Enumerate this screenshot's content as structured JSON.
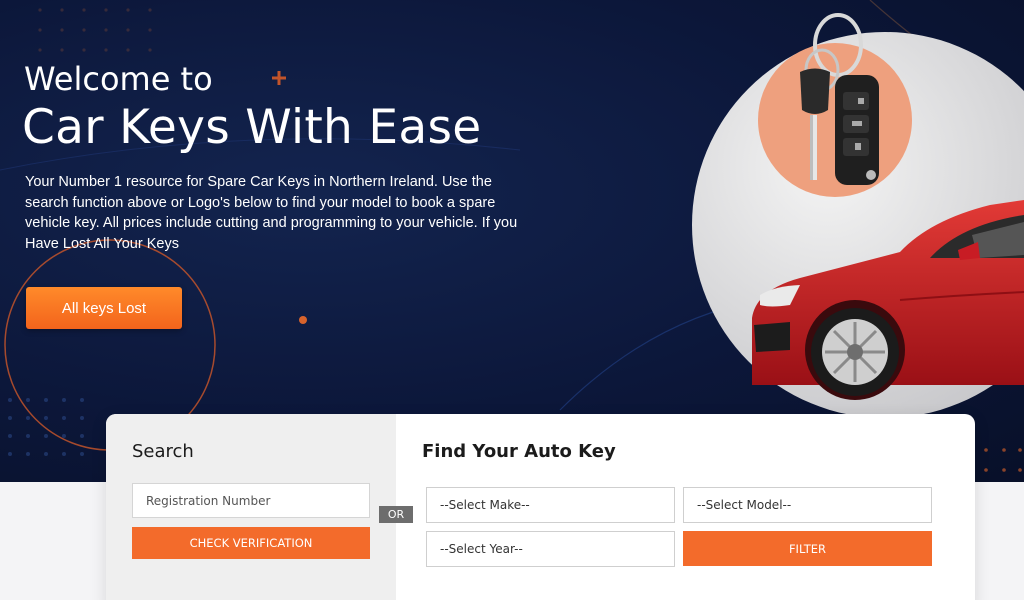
{
  "hero": {
    "welcome": "Welcome to",
    "title": "Car Keys With Ease",
    "description": "Your Number 1 resource for Spare Car Keys in Northern Ireland. Use the search function above or Logo's below to find your model to book a spare vehicle key. All prices include cutting and programming to your vehicle. If you Have Lost All Your Keys",
    "lost_button": "All keys Lost"
  },
  "search": {
    "heading": "Search",
    "registration_placeholder": "Registration Number",
    "check_button": "CHECK VERIFICATION",
    "or_label": "OR"
  },
  "finder": {
    "heading": "Find Your Auto Key",
    "make": "--Select Make--",
    "model": "--Select Model--",
    "year": "--Select Year--",
    "filter_button": "FILTER"
  },
  "colors": {
    "accent": "#f36b2b",
    "hero_bg": "#0c173a",
    "car_red": "#d0202a"
  },
  "icons": [
    "car-key-icon",
    "car-image"
  ]
}
